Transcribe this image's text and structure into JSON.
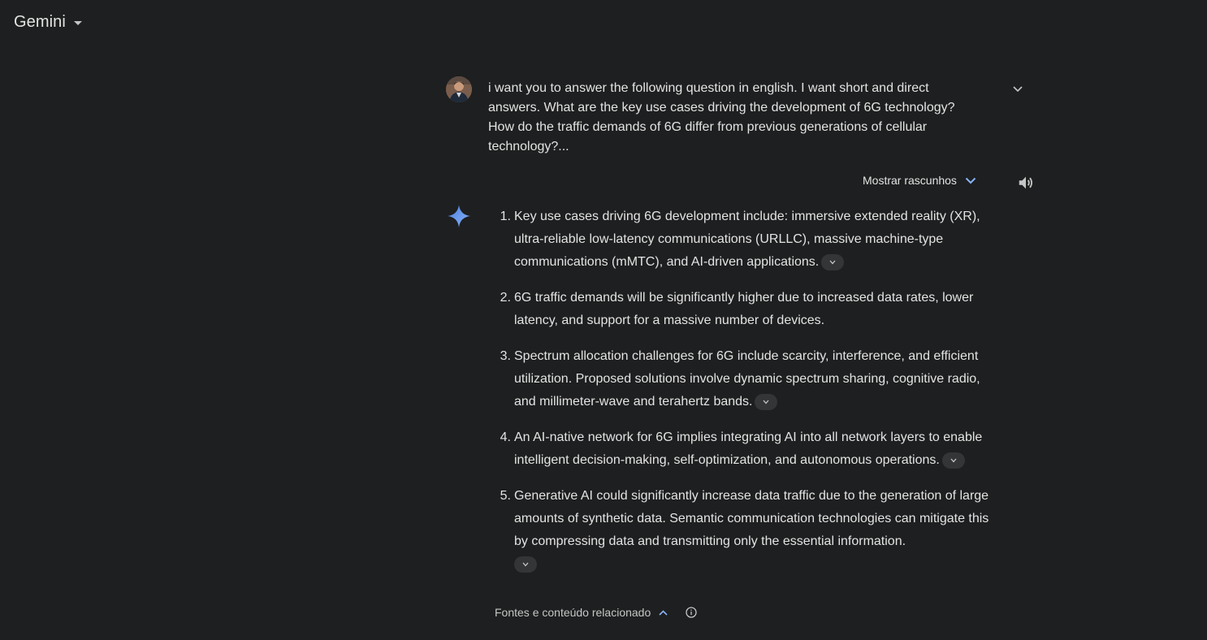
{
  "app": {
    "title": "Gemini"
  },
  "prompt": {
    "text": "i want you to answer the following question in english. I want short and direct answers. What are the key use cases driving the development of 6G technology? How do the traffic demands of 6G differ from previous generations of cellular technology?..."
  },
  "response": {
    "drafts_label": "Mostrar rascunhos",
    "items": [
      {
        "num": "1.",
        "text": "Key use cases driving 6G development include: immersive extended reality (XR), ultra-reliable low-latency communications (URLLC), massive machine-type communications (mMTC), and AI-driven applications."
      },
      {
        "num": "2.",
        "text": "6G traffic demands will be significantly higher due to increased data rates, lower latency, and support for a massive number of devices."
      },
      {
        "num": "3.",
        "text": "Spectrum allocation challenges for 6G include scarcity, interference, and efficient utilization. Proposed solutions involve dynamic spectrum sharing, cognitive radio, and millimeter-wave and terahertz bands."
      },
      {
        "num": "4.",
        "text": "An AI-native network for 6G implies integrating AI into all network layers to enable intelligent decision-making, self-optimization, and autonomous operations."
      },
      {
        "num": "5.",
        "text": "Generative AI could significantly increase data traffic due to the generation of large amounts of synthetic data. Semantic communication technologies can mitigate this by compressing data and transmitting only the essential information."
      }
    ],
    "sources_label": "Fontes e conteúdo relacionado"
  },
  "icons": {
    "title_caret": "dropdown-caret-icon",
    "expand_prompt": "chevron-down-icon",
    "drafts": "chevron-down-icon",
    "speaker": "speaker-icon",
    "gemini": "gemini-sparkle-icon",
    "citation": "chevron-down-icon",
    "sources": "chevron-up-icon",
    "info": "info-icon"
  },
  "colors": {
    "background": "#1e1f20",
    "text": "#e3e3e3",
    "muted": "#c4c7c5",
    "accent_blue": "#8ab4f8",
    "chip_bg": "#333537"
  }
}
